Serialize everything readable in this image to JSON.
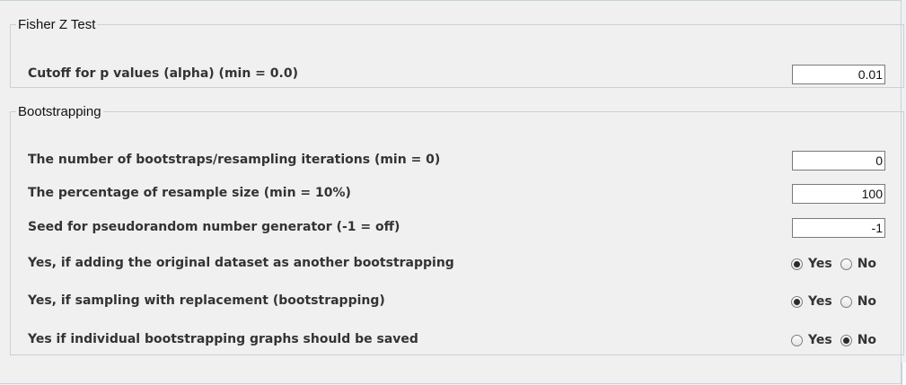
{
  "fisher": {
    "legend": "Fisher Z Test",
    "alpha_label": "Cutoff for p values (alpha) (min = 0.0)",
    "alpha_value": "0.01"
  },
  "bootstrapping": {
    "legend": "Bootstrapping",
    "iterations_label": "The number of bootstraps/resampling iterations (min = 0)",
    "iterations_value": "0",
    "resample_label": "The percentage of resample size (min = 10%)",
    "resample_value": "100",
    "seed_label": "Seed for pseudorandom number generator (-1 = off)",
    "seed_value": "-1",
    "add_original_label": "Yes, if adding the original dataset as another bootstrapping",
    "add_original_selected": "Yes",
    "replacement_label": "Yes, if sampling with replacement (bootstrapping)",
    "replacement_selected": "Yes",
    "save_graphs_label": "Yes if individual bootstrapping graphs should be saved",
    "save_graphs_selected": "No",
    "yes_label": "Yes",
    "no_label": "No"
  }
}
